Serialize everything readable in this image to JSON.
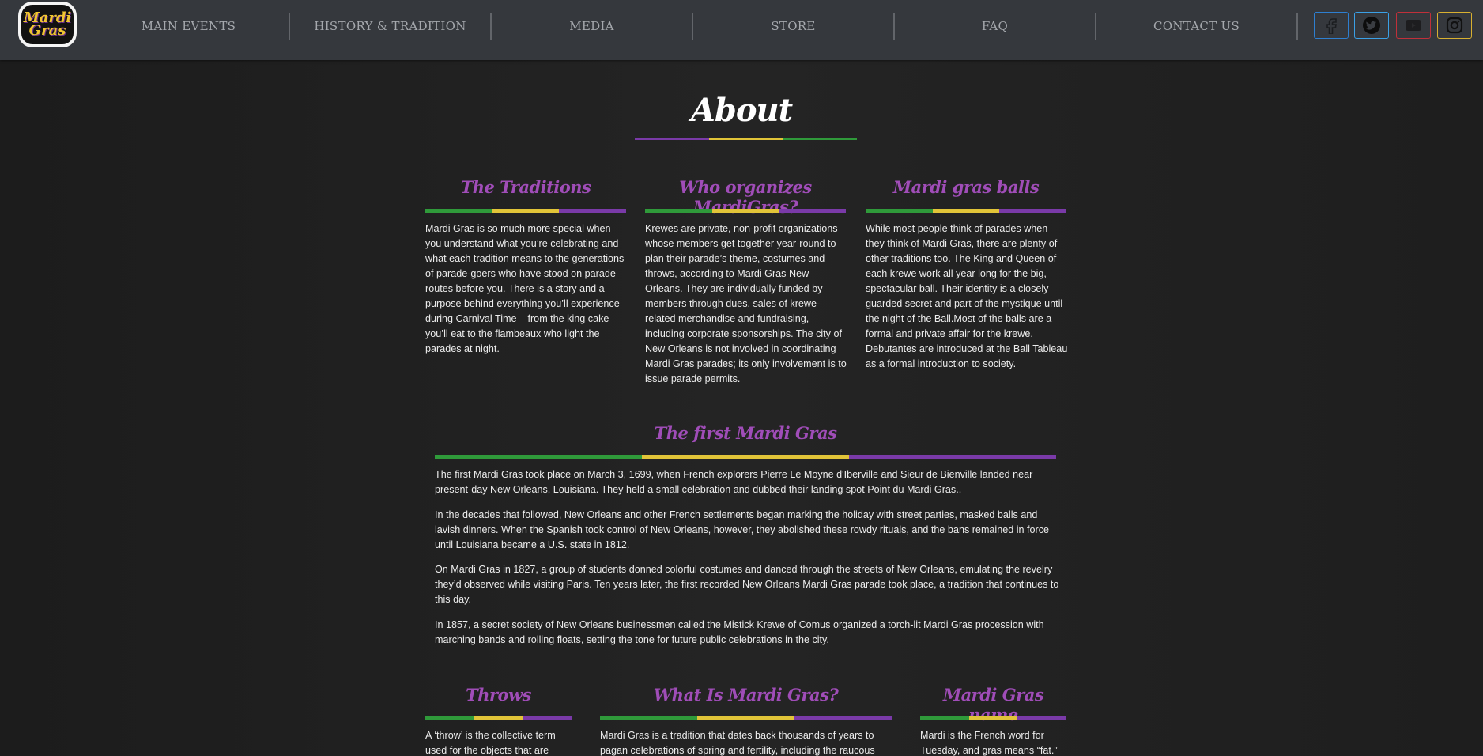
{
  "logo": {
    "line1": "Mardi",
    "line2": "Gras"
  },
  "nav": {
    "items": [
      {
        "label": "MAIN EVENTS"
      },
      {
        "label": "HISTORY & TRADITION"
      },
      {
        "label": "MEDIA"
      },
      {
        "label": "STORE"
      },
      {
        "label": "FAQ"
      },
      {
        "label": "CONTACT US"
      }
    ],
    "social": [
      "facebook-icon",
      "twitter-icon",
      "youtube-icon",
      "instagram-icon"
    ]
  },
  "colors": {
    "purple": "#7a3aa8",
    "gold": "#e1c438",
    "green": "#2f9a3a",
    "heading": "#a04db8"
  },
  "about": {
    "title": "About"
  },
  "sections": {
    "traditions": {
      "title": "The Traditions",
      "text": "Mardi Gras is so much more special when you understand what you’re celebrating and what each tradition means to the generations of parade-goers who have stood on parade routes before you. There is a story and a purpose behind everything you’ll experience during Carnival Time – from the king cake you’ll eat to the flambeaux who light the parades at night."
    },
    "organizers": {
      "title": "Who organizes MardiGras?",
      "text": "Krewes are private, non-profit organizations whose members get together year-round to plan their parade’s theme, costumes and throws, according to Mardi Gras New Orleans. They are individually funded by members through dues, sales of krewe-related merchandise and fundraising, including corporate sponsorships. The city of New Orleans is not involved in coordinating Mardi Gras parades; its only involvement is to issue parade permits."
    },
    "balls": {
      "title": "Mardi gras balls",
      "text": "While most people think of parades when they think of Mardi Gras, there are plenty of other traditions too. The King and Queen of each krewe work all year long for the big, spectacular ball. Their identity is a closely guarded secret and part of the mystique until the night of the Ball.Most of the balls are a formal and private affair for the krewe. Debutantes are introduced at the Ball Tableau as a formal introduction to society."
    },
    "first": {
      "title": "The first Mardi Gras",
      "paragraphs": [
        "The first Mardi Gras took place on March 3, 1699, when French explorers Pierre Le Moyne d'Iberville and Sieur de Bienville landed near present-day New Orleans, Louisiana. They held a small celebration and dubbed their landing spot Point du Mardi Gras..",
        "In the decades that followed, New Orleans and other French settlements began marking the holiday with street parties, masked balls and lavish dinners. When the Spanish took control of New Orleans, however, they abolished these rowdy rituals, and the bans remained in force until Louisiana became a U.S. state in 1812.",
        "On Mardi Gras in 1827, a group of students donned colorful costumes and danced through the streets of New Orleans, emulating the revelry they’d observed while visiting Paris. Ten years later, the first recorded New Orleans Mardi Gras parade took place, a tradition that continues to this day.",
        "In 1857, a secret society of New Orleans businessmen called the Mistick Krewe of Comus organized a torch-lit Mardi Gras procession with marching bands and rolling floats, setting the tone for future public celebrations in the city."
      ]
    },
    "throws": {
      "title": "Throws",
      "text": "A ‘throw’ is the collective term used for the objects that are"
    },
    "what": {
      "title": "What Is Mardi Gras?",
      "text": "Mardi Gras is a tradition that dates back thousands of years to pagan celebrations of spring and fertility, including the raucous"
    },
    "name": {
      "title": "Mardi Gras name",
      "text": "Mardi is the French word for Tuesday, and gras means “fat.”"
    }
  }
}
